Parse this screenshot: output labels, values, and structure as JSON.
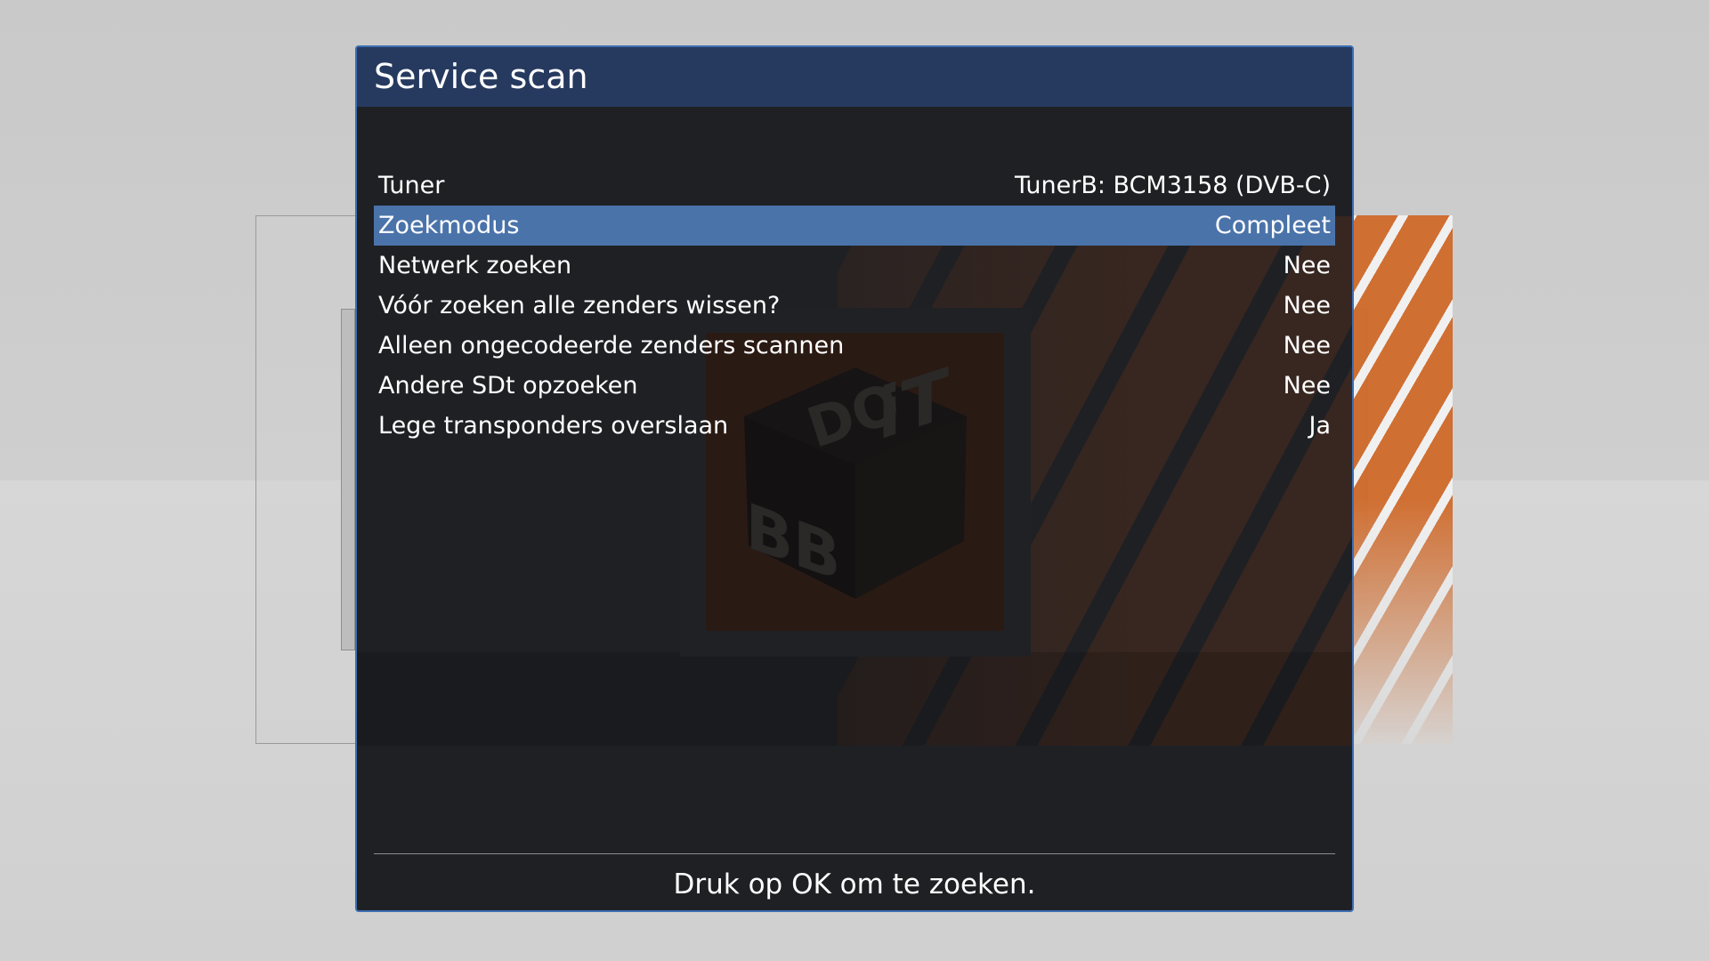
{
  "dialog": {
    "title": "Service scan",
    "footer_hint": "Druk op OK om te zoeken."
  },
  "settings": [
    {
      "label": "Tuner",
      "value": "TunerB: BCM3158 (DVB-C)",
      "selected": false
    },
    {
      "label": "Zoekmodus",
      "value": "Compleet",
      "selected": true
    },
    {
      "label": "Netwerk zoeken",
      "value": "Nee",
      "selected": false
    },
    {
      "label": "Vóór zoeken alle zenders wissen?",
      "value": "Nee",
      "selected": false
    },
    {
      "label": "Alleen ongecodeerde zenders scannen",
      "value": "Nee",
      "selected": false
    },
    {
      "label": "Andere SDt opzoeken",
      "value": "Nee",
      "selected": false
    },
    {
      "label": "Lege transponders overslaan",
      "value": "Ja",
      "selected": false
    }
  ],
  "colors": {
    "header_bg": "#263a5f",
    "dialog_bg": "#1f2024",
    "selection_bg": "#4a73aa",
    "border": "#3d6fb5",
    "accent_orange": "#d06a2a"
  },
  "background_logo": {
    "icon": "dobbit-cube-logo",
    "letters_top": "DO",
    "letters_left": "BB",
    "letters_right": "iT"
  }
}
